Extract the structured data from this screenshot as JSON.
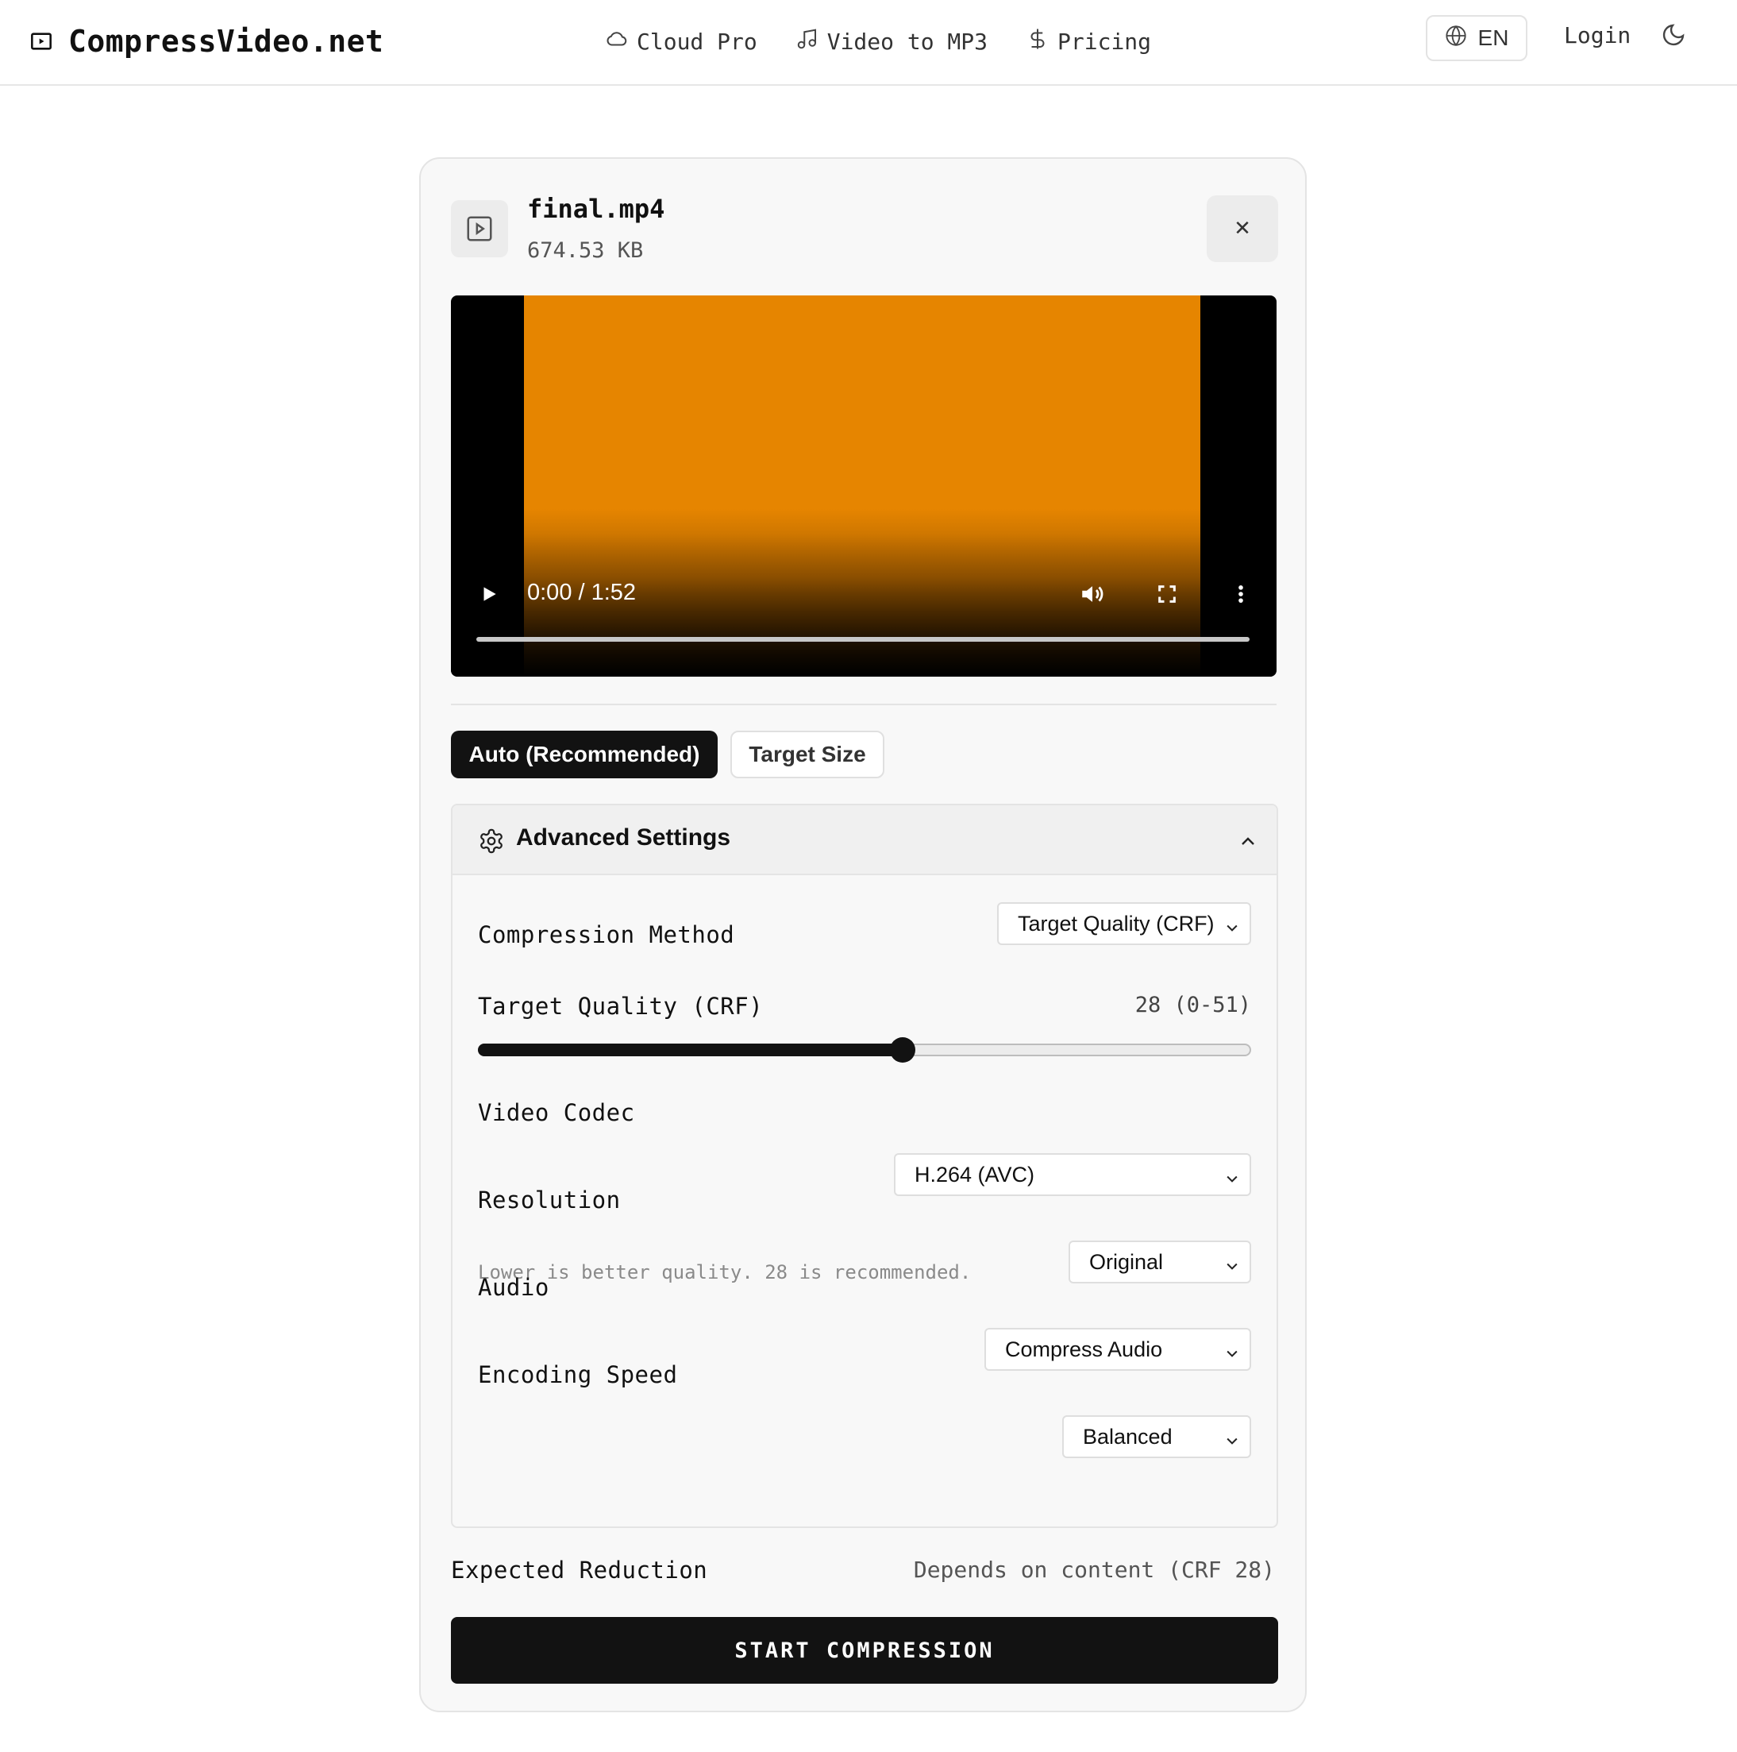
{
  "header": {
    "brand": "CompressVideo.net",
    "nav": [
      {
        "label": "Cloud Pro",
        "icon": "cloud-icon"
      },
      {
        "label": "Video to MP3",
        "icon": "music-note-icon"
      },
      {
        "label": "Pricing",
        "icon": "dollar-icon"
      }
    ],
    "language": "EN",
    "login": "Login"
  },
  "file": {
    "name": "final.mp4",
    "size": "674.53 KB"
  },
  "player": {
    "time": "0:00 / 1:52",
    "frame_color": "#E68500"
  },
  "modes": {
    "auto": "Auto (Recommended)",
    "target": "Target Size",
    "active": "auto"
  },
  "advanced": {
    "title": "Advanced Settings",
    "expanded": true,
    "compression_method": {
      "label": "Compression Method",
      "value": "Target Quality (CRF)"
    },
    "crf": {
      "label": "Target Quality (CRF)",
      "value_text": "28 (0-51)",
      "value": 28,
      "min": 0,
      "max": 51,
      "hint": "Lower is better quality. 28 is recommended."
    },
    "video_codec": {
      "label": "Video Codec",
      "value": "H.264 (AVC)"
    },
    "resolution": {
      "label": "Resolution",
      "value": "Original"
    },
    "audio": {
      "label": "Audio",
      "value": "Compress Audio"
    },
    "encoding_speed": {
      "label": "Encoding Speed",
      "value": "Balanced"
    }
  },
  "summary": {
    "label": "Expected Reduction",
    "value": "Depends on content (CRF 28)"
  },
  "start_button": "START COMPRESSION",
  "colors": {
    "primary": "#121212",
    "accent_video": "#E68500"
  }
}
